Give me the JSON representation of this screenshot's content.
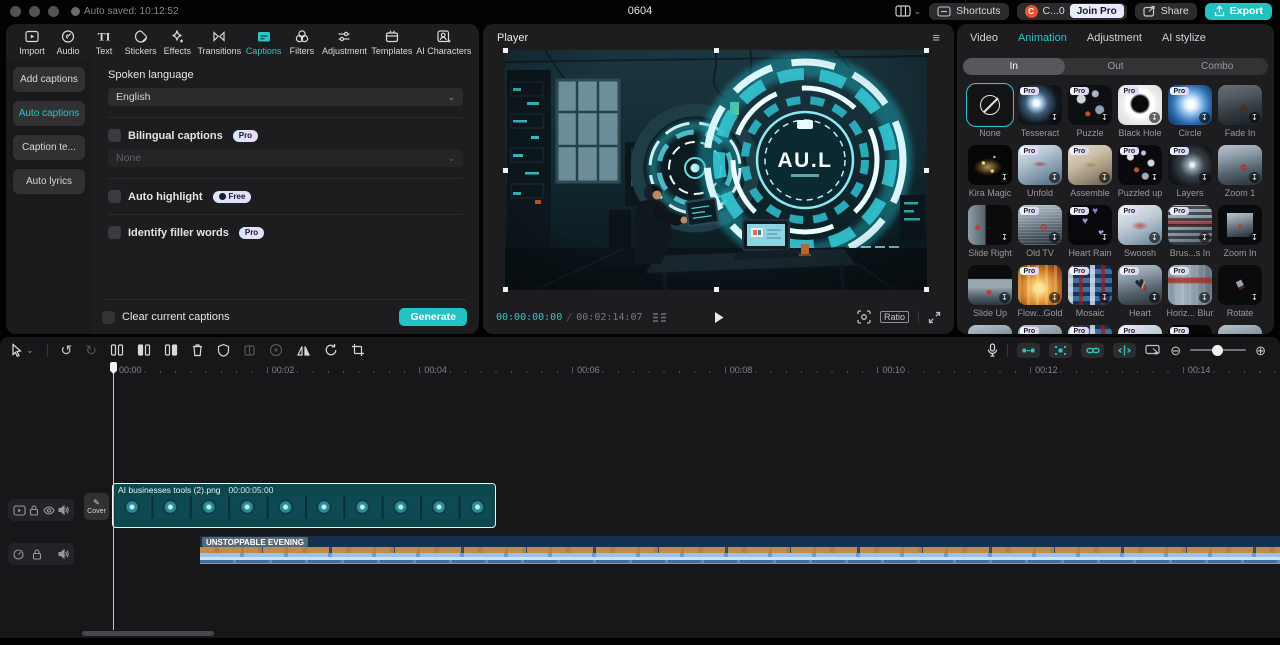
{
  "titlebar": {
    "auto_saved": "Auto saved: 10:12:52",
    "doc_title": "0604",
    "shortcuts_label": "Shortcuts",
    "account_label": "C...0",
    "avatar_letter": "C",
    "join_pro_label": "Join Pro",
    "share_label": "Share",
    "export_label": "Export"
  },
  "icons": {
    "chevron_down": "⌄",
    "menu": "≡",
    "undo": "↺",
    "redo": "↻",
    "zoom_out": "⊖",
    "zoom_in": "⊕",
    "download": "↧",
    "pencil": "✎"
  },
  "toolbar": {
    "items": [
      "Import",
      "Audio",
      "Text",
      "Stickers",
      "Effects",
      "Transitions",
      "Captions",
      "Filters",
      "Adjustment",
      "Templates",
      "AI Characters"
    ],
    "active": "Captions"
  },
  "captions_panel": {
    "sidebar": [
      "Add captions",
      "Auto captions",
      "Caption te...",
      "Auto lyrics"
    ],
    "active_sidebar": "Auto captions",
    "spoken_language_label": "Spoken language",
    "language_value": "English",
    "bilingual_label": "Bilingual captions",
    "bilingual_select_value": "None",
    "auto_highlight_label": "Auto highlight",
    "filler_words_label": "Identify filler words",
    "clear_label": "Clear current captions",
    "generate_label": "Generate",
    "pro_badge": "Pro",
    "free_badge": "Free"
  },
  "player": {
    "title": "Player",
    "current_time": "00:00:00:00",
    "duration": "00:02:14:07",
    "ratio_label": "Ratio",
    "video_overlay_text": "AU.L"
  },
  "right_panel": {
    "tabs": [
      "Video",
      "Animation",
      "Adjustment",
      "AI stylize"
    ],
    "active_tab": "Animation",
    "segments": [
      "In",
      "Out",
      "Combo"
    ],
    "active_segment": "In",
    "pro_badge_label": "Pro",
    "presets": [
      {
        "label": "None",
        "variant": "none",
        "pro": false,
        "selected": true
      },
      {
        "label": "Tesseract",
        "variant": "tesseract",
        "pro": true
      },
      {
        "label": "Puzzle",
        "variant": "puzzle",
        "pro": true
      },
      {
        "label": "Black Hole",
        "variant": "blackhole",
        "pro": true
      },
      {
        "label": "Circle",
        "variant": "circle",
        "pro": true
      },
      {
        "label": "Fade In",
        "variant": "fade",
        "pro": false
      },
      {
        "label": "Kira Magic",
        "variant": "kira",
        "pro": false
      },
      {
        "label": "Unfold",
        "variant": "unfold",
        "pro": true
      },
      {
        "label": "Assemble",
        "variant": "assemble",
        "pro": true
      },
      {
        "label": "Puzzled up",
        "variant": "puzzledup",
        "pro": true
      },
      {
        "label": "Layers",
        "variant": "layers",
        "pro": true
      },
      {
        "label": "Zoom 1",
        "variant": "zoom1",
        "pro": false
      },
      {
        "label": "Slide Right",
        "variant": "slideright",
        "pro": false
      },
      {
        "label": "Old TV",
        "variant": "oldtv",
        "pro": true
      },
      {
        "label": "Heart Rain",
        "variant": "heartrain",
        "pro": true
      },
      {
        "label": "Swoosh",
        "variant": "swoosh",
        "pro": true
      },
      {
        "label": "Brus...s In",
        "variant": "brushin",
        "pro": true
      },
      {
        "label": "Zoom In",
        "variant": "zoomin",
        "pro": false
      },
      {
        "label": "Slide Up",
        "variant": "slideup",
        "pro": false
      },
      {
        "label": "Flow...Gold",
        "variant": "flowgold",
        "pro": true
      },
      {
        "label": "Mosaic",
        "variant": "mosaic",
        "pro": true
      },
      {
        "label": "Heart",
        "variant": "heart",
        "pro": true
      },
      {
        "label": "Horiz... Blur",
        "variant": "horizblur",
        "pro": true
      },
      {
        "label": "Rotate",
        "variant": "rotate",
        "pro": false
      },
      {
        "label": "",
        "variant": "scene",
        "pro": false
      },
      {
        "label": "",
        "variant": "scene",
        "pro": true
      },
      {
        "label": "",
        "variant": "mosaic",
        "pro": true
      },
      {
        "label": "",
        "variant": "swoosh",
        "pro": true
      },
      {
        "label": "",
        "variant": "kira",
        "pro": true
      },
      {
        "label": "",
        "variant": "scene",
        "pro": false
      }
    ]
  },
  "timeline": {
    "ruler_labels": [
      "00:00",
      "00:02",
      "00:04",
      "00:06",
      "00:08",
      "00:10",
      "00:12",
      "00:14"
    ],
    "cover_label": "Cover",
    "video_clip": {
      "name": "AI businesses tools (2).png",
      "duration": "00:00:05:00"
    },
    "audio_clip": {
      "name": "UNSTOPPABLE EVENING"
    }
  },
  "colors": {
    "accent": "#2bc5c7",
    "export_button": "#23c2c2",
    "clip_teal": "#0e4a52",
    "audio_blue": "#16304f",
    "wave_orange": "#c28a4e"
  }
}
